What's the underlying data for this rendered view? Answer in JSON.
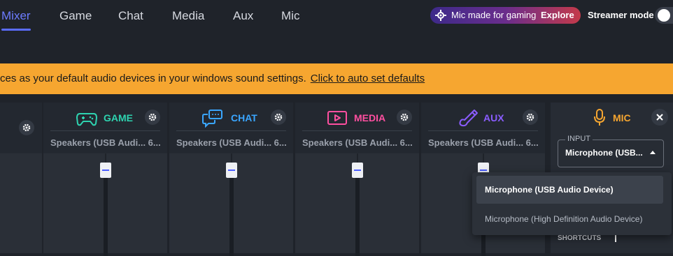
{
  "tabs": [
    {
      "label": "Mixer",
      "active": true
    },
    {
      "label": "Game",
      "active": false
    },
    {
      "label": "Chat",
      "active": false
    },
    {
      "label": "Media",
      "active": false
    },
    {
      "label": "Aux",
      "active": false
    },
    {
      "label": "Mic",
      "active": false
    }
  ],
  "promo": {
    "text": "Mic made for gaming",
    "cta": "Explore"
  },
  "streamer_mode": {
    "label": "Streamer mode",
    "on": false
  },
  "banner": {
    "text": "ces as your default audio devices in your windows sound settings.",
    "link": "Click to auto set defaults"
  },
  "channels": [
    {
      "name": "GAME",
      "device": "Speakers (USB Audi... 6...",
      "color": "#2ed3b0",
      "icon": "gamepad-icon"
    },
    {
      "name": "CHAT",
      "device": "Speakers (USB Audi... 6...",
      "color": "#3aa6ff",
      "icon": "chat-bubbles-icon"
    },
    {
      "name": "MEDIA",
      "device": "Speakers (USB Audi... 6...",
      "color": "#ff4fa0",
      "icon": "play-box-icon"
    },
    {
      "name": "AUX",
      "device": "Speakers (USB Audi... 6...",
      "color": "#8a5cff",
      "icon": "instrument-icon"
    }
  ],
  "mic": {
    "name": "MIC",
    "color": "#f6a630",
    "input_legend": "INPUT",
    "input_value": "Microphone (USB...",
    "options": [
      "Microphone (USB Audio Device)",
      "Microphone (High Definition Audio Device)"
    ],
    "shortcuts_label": "SHORTCUTS"
  }
}
